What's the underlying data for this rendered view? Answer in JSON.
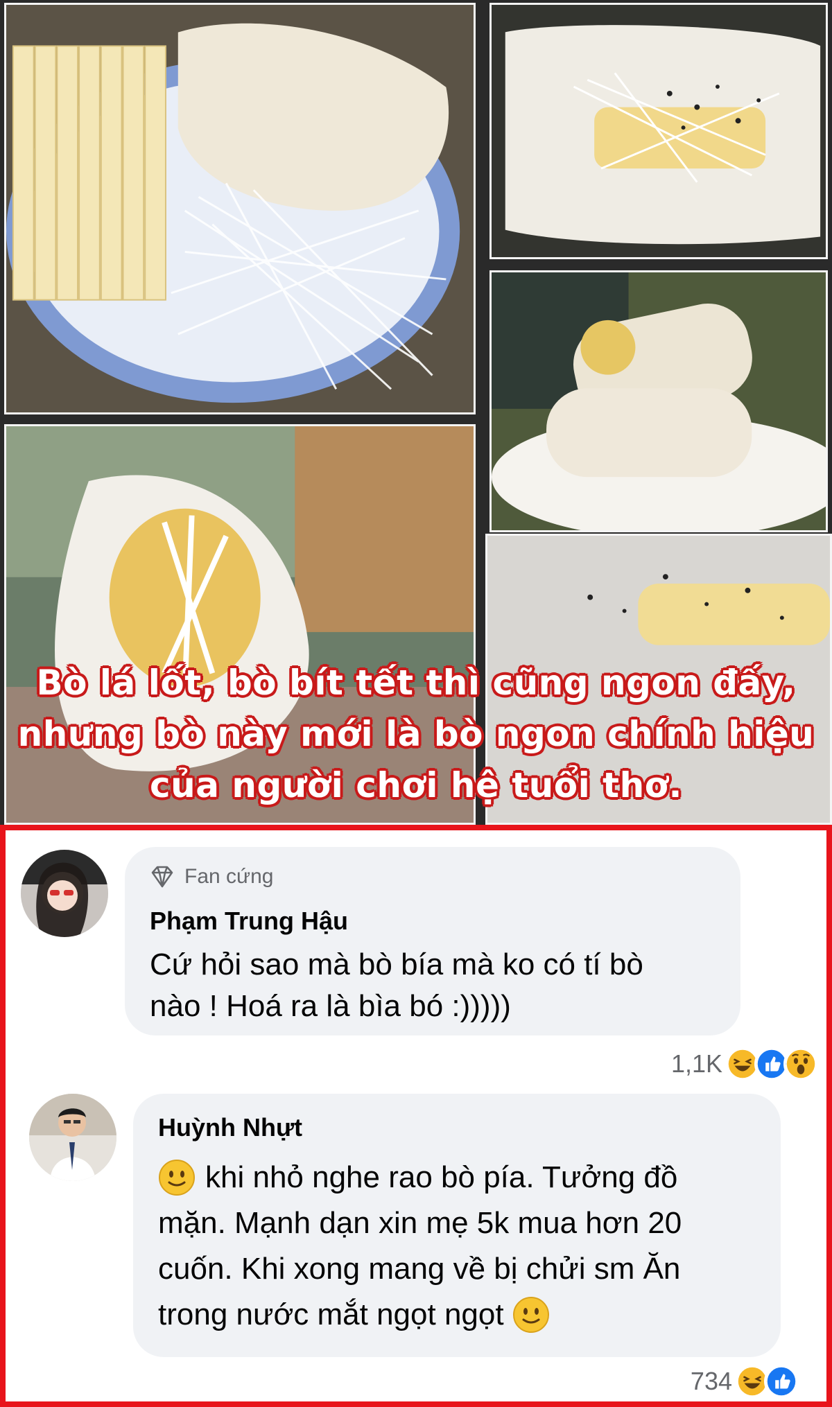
{
  "post": {
    "caption_lines": [
      "Bò lá lốt, bò bít tết thì cũng ngon đấy,",
      "nhưng bò này mới là bò ngon chính hiệu",
      "của người chơi hệ tuổi thơ."
    ]
  },
  "comments": [
    {
      "badge_icon": "diamond-icon",
      "badge": "Fan cứng",
      "author": "Phạm Trung Hậu",
      "text_lines": [
        "Cứ hỏi sao mà bò bía mà ko có tí bò",
        "nào ! Hoá ra là bìa bó :)))))"
      ],
      "reaction_count": "1,1K",
      "reactions": [
        "haha-icon",
        "like-icon",
        "wow-icon"
      ]
    },
    {
      "author": "Huỳnh Nhựt",
      "text_lines": [
        "khi nhỏ nghe rao bò pía. Tưởng đồ",
        "mặn. Mạnh dạn xin mẹ 5k mua hơn 20",
        "cuốn. Khi xong mang về bị chửi sm   Ăn",
        "trong nước mắt ngọt ngọt"
      ],
      "reaction_count": "734",
      "reactions": [
        "haha-icon",
        "like-icon"
      ]
    }
  ],
  "colors": {
    "frame_red": "#e8141b",
    "caption_outline": "#c81a1a",
    "bubble_bg": "#f0f2f5",
    "like_blue": "#1877f2",
    "emoji_yellow": "#f7b928"
  }
}
